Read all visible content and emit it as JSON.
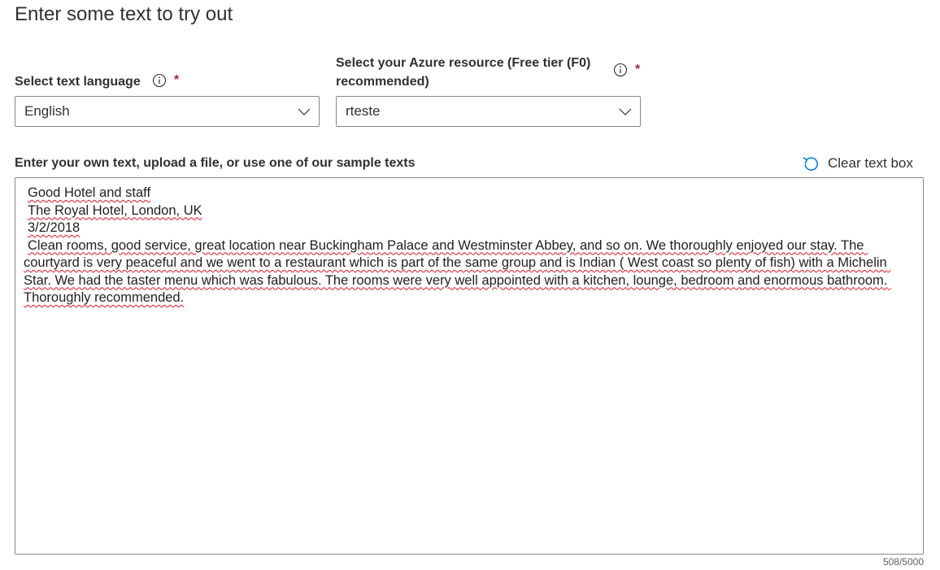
{
  "page": {
    "title": "Enter some text to try out"
  },
  "language_field": {
    "label": "Select text language",
    "required_marker": "*",
    "selected": "English"
  },
  "resource_field": {
    "label_line1": "Select your Azure resource (Free tier (F0)",
    "label_line2": "recommended)",
    "required_marker": "*",
    "selected": "rteste"
  },
  "text_input": {
    "label": "Enter your own text, upload a file, or use one of our sample texts",
    "clear_label": "Clear text box",
    "lines": [
      "Good Hotel and staff",
      "The Royal Hotel, London, UK",
      "3/2/2018",
      "Clean rooms, good service, great location near Buckingham Palace and Westminster Abbey, and so on. We thoroughly enjoyed our stay. The courtyard is very peaceful and we went to a restaurant which is part of the same group and is Indian ( West coast so plenty of fish) with a Michelin Star. We had the taster menu which was fabulous. The rooms were very well appointed with a kitchen, lounge, bedroom and enormous bathroom. Thoroughly recommended."
    ],
    "char_count": "508/5000"
  },
  "icons": {
    "info": "info-circle-icon",
    "dropdown": "chevron-down-icon",
    "clear": "undo-icon"
  },
  "colors": {
    "required": "#a4262c",
    "clear_icon": "#0078d4",
    "spellcheck": "#e81123",
    "border": "#8a8886"
  }
}
